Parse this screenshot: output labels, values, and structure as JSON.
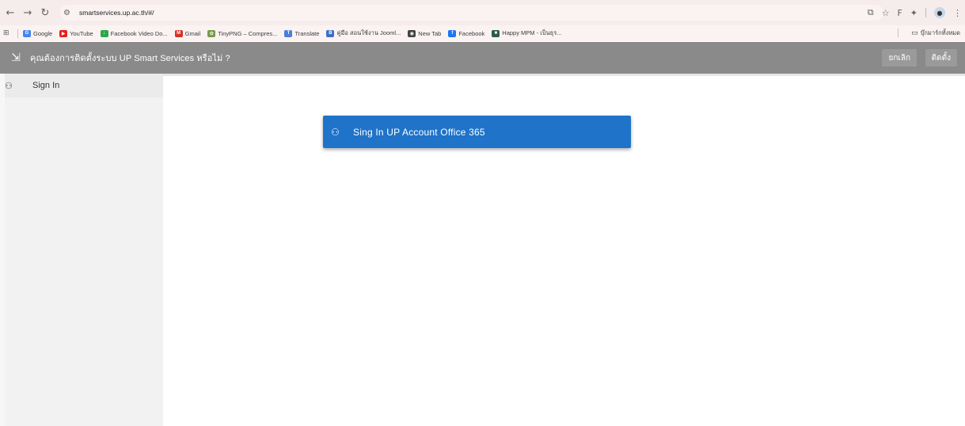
{
  "browser": {
    "url": "smartservices.up.ac.th/#/",
    "profile_initial": "F"
  },
  "bookmarks": [
    {
      "label": "Google",
      "icon": "google-icon",
      "color": "#4285f4",
      "glyph": "G"
    },
    {
      "label": "YouTube",
      "icon": "youtube-icon",
      "color": "#e62117",
      "glyph": "▶"
    },
    {
      "label": "Facebook Video Do...",
      "icon": "download-icon",
      "color": "#2aa84a",
      "glyph": "↓"
    },
    {
      "label": "Gmail",
      "icon": "gmail-icon",
      "color": "#d93025",
      "glyph": "M"
    },
    {
      "label": "TinyPNG – Compres...",
      "icon": "panda-icon",
      "color": "#7a9a4a",
      "glyph": "✿"
    },
    {
      "label": "Translate",
      "icon": "translate-icon",
      "color": "#4a7fd8",
      "glyph": "T"
    },
    {
      "label": "คู่มือ สอนใช้งาน Jooml...",
      "icon": "bookmark-icon",
      "color": "#3a6fc8",
      "glyph": "B"
    },
    {
      "label": "New Tab",
      "icon": "globe-icon",
      "color": "#444444",
      "glyph": "◉"
    },
    {
      "label": "Facebook",
      "icon": "facebook-icon",
      "color": "#1877f2",
      "glyph": "f"
    },
    {
      "label": "Happy MPM - เป็นธุร...",
      "icon": "app-icon",
      "color": "#2b5b4b",
      "glyph": "■"
    }
  ],
  "bookmarks_all_label": "บุ๊กมาร์กทั้งหมด",
  "install_prompt": {
    "text": "คุณต้องการติดตั้งระบบ UP Smart Services หรือไม่ ?",
    "cancel_label": "ยกเลิก",
    "install_label": "ติดตั้ง"
  },
  "sidebar": {
    "items": [
      {
        "label": "Sign In",
        "icon": "person-add-icon"
      }
    ]
  },
  "main": {
    "signin_button_label": "Sing In UP Account Office 365"
  },
  "colors": {
    "install_bar": "#8a8a8a",
    "signin_button": "#1f73c9",
    "browser_chrome": "#f6ecec"
  }
}
